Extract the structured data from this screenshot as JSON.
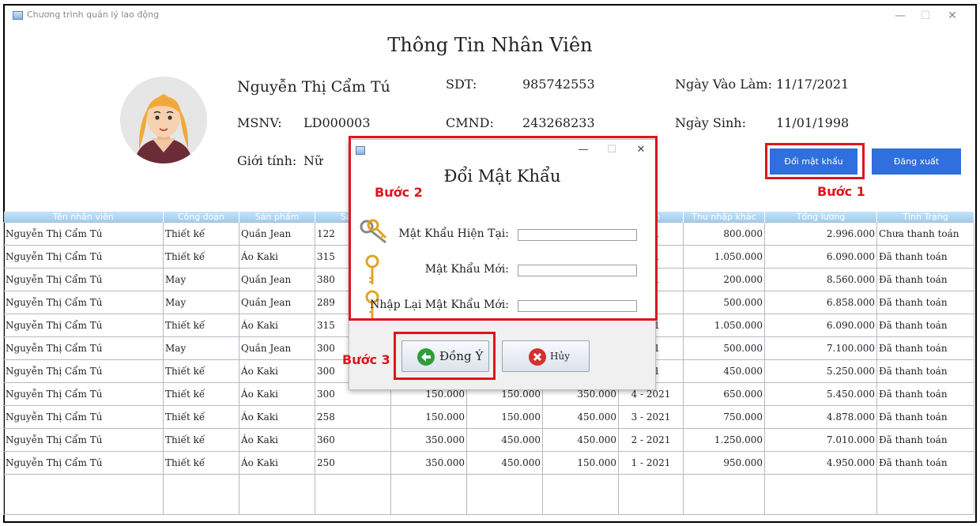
{
  "window": {
    "title": "Chương trình quản lý lao động",
    "minimize": "—",
    "maximize": "☐",
    "close": "✕"
  },
  "header": {
    "title": "Thông Tin Nhân Viên"
  },
  "profile": {
    "name": "Nguyễn Thị Cẩm Tú",
    "msnv_label": "MSNV:",
    "msnv": "LD000003",
    "gender_label": "Giới tính:",
    "gender": "Nữ",
    "phone_label": "SDT:",
    "phone": "985742553",
    "id_label": "CMND:",
    "id": "243268233",
    "start_label": "Ngày Vào Làm:",
    "start_date": "11/17/2021",
    "birth_label": "Ngày Sinh:",
    "birth_date": "11/01/1998"
  },
  "actions": {
    "change_password": "Đổi mật khẩu",
    "logout": "Đăng xuất"
  },
  "steps": {
    "step1": "Bước 1",
    "step2": "Bước 2",
    "step3": "Bước 3"
  },
  "table": {
    "columns": [
      "Tên nhân viên",
      "Công đoạn",
      "Sản phẩm",
      "Sản p",
      "",
      "",
      "",
      "gian",
      "Thu nhập khác",
      "Tổng lương",
      "Tình Trạng"
    ],
    "rows": [
      [
        "Nguyễn Thị Cẩm Tú",
        "Thiết kế",
        "Quần Jean",
        "122",
        "",
        "",
        "",
        "021",
        "800.000",
        "2.996.000",
        "Chưa thanh toán"
      ],
      [
        "Nguyễn Thị Cẩm Tú",
        "Thiết kế",
        "Áo Kaki",
        "315",
        "",
        "",
        "",
        "021",
        "1.050.000",
        "6.090.000",
        "Đã thanh toán"
      ],
      [
        "Nguyễn Thị Cẩm Tú",
        "May",
        "Quần Jean",
        "380",
        "",
        "",
        "",
        "021",
        "200.000",
        "8.560.000",
        "Đã thanh toán"
      ],
      [
        "Nguyễn Thị Cẩm Tú",
        "May",
        "Quần Jean",
        "289",
        "",
        "",
        "",
        "21",
        "500.000",
        "6.858.000",
        "Đã thanh toán"
      ],
      [
        "Nguyễn Thị Cẩm Tú",
        "Thiết kế",
        "Áo Kaki",
        "315",
        "",
        "",
        "",
        "021",
        "1.050.000",
        "6.090.000",
        "Đã thanh toán"
      ],
      [
        "Nguyễn Thị Cẩm Tú",
        "May",
        "Quần Jean",
        "300",
        "",
        "",
        "",
        "021",
        "500.000",
        "7.100.000",
        "Đã thanh toán"
      ],
      [
        "Nguyễn Thị Cẩm Tú",
        "Thiết kế",
        "Áo Kaki",
        "300",
        "",
        "",
        "",
        "021",
        "450.000",
        "5.250.000",
        "Đã thanh toán"
      ],
      [
        "Nguyễn Thị Cẩm Tú",
        "Thiết kế",
        "Áo Kaki",
        "300",
        "150.000",
        "150.000",
        "350.000",
        "4 - 2021",
        "650.000",
        "5.450.000",
        "Đã thanh toán"
      ],
      [
        "Nguyễn Thị Cẩm Tú",
        "Thiết kế",
        "Áo Kaki",
        "258",
        "150.000",
        "150.000",
        "450.000",
        "3 - 2021",
        "750.000",
        "4.878.000",
        "Đã thanh toán"
      ],
      [
        "Nguyễn Thị Cẩm Tú",
        "Thiết kế",
        "Áo Kaki",
        "360",
        "350.000",
        "450.000",
        "450.000",
        "2 - 2021",
        "1.250.000",
        "7.010.000",
        "Đã thanh toán"
      ],
      [
        "Nguyễn Thị Cẩm Tú",
        "Thiết kế",
        "Áo Kaki",
        "250",
        "350.000",
        "450.000",
        "150.000",
        "1 - 2021",
        "950.000",
        "4.950.000",
        "Đã thanh toán"
      ]
    ]
  },
  "dialog": {
    "title": "Đổi Mật Khẩu",
    "current_label": "Mật Khẩu Hiện Tại:",
    "current_value": "",
    "new_label": "Mật Khẩu Mới:",
    "new_value": "",
    "confirm_label": "Nhập Lại Mật Khẩu Mới:",
    "confirm_value": "",
    "ok": "Đồng Ý",
    "cancel": "Hủy",
    "minimize": "—",
    "maximize": "☐",
    "close": "✕"
  },
  "icons": {
    "ok": "arrow-left-circle-icon",
    "cancel": "x-circle-icon",
    "keys": "key-icon"
  },
  "colors": {
    "accent": "#2f6fde",
    "highlight": "#e0141e",
    "header": "#a9d4f2"
  }
}
